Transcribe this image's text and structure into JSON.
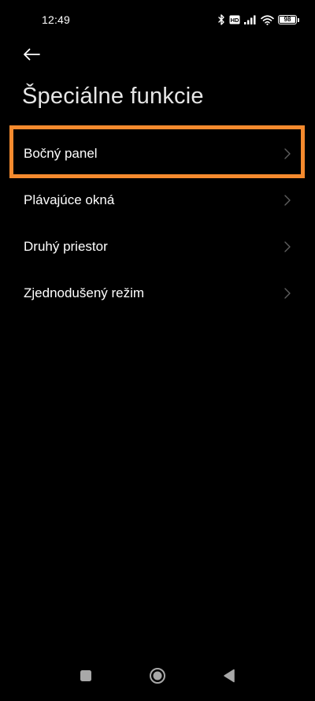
{
  "status_bar": {
    "time": "12:49",
    "network_label": "HD",
    "battery": "98",
    "icons": [
      "bluetooth-icon",
      "hd-icon",
      "signal-icon",
      "wifi-icon",
      "battery-icon"
    ]
  },
  "header": {
    "back_icon": "arrow-left-icon",
    "title": "Špeciálne funkcie"
  },
  "list": {
    "items": [
      {
        "label": "Bočný panel"
      },
      {
        "label": "Plávajúce okná"
      },
      {
        "label": "Druhý priestor"
      },
      {
        "label": "Zjednodušený režim"
      }
    ]
  },
  "highlight_color": "#f58a2e",
  "nav_bar": {
    "buttons": [
      "recents-square-icon",
      "home-circle-icon",
      "back-triangle-icon"
    ]
  }
}
